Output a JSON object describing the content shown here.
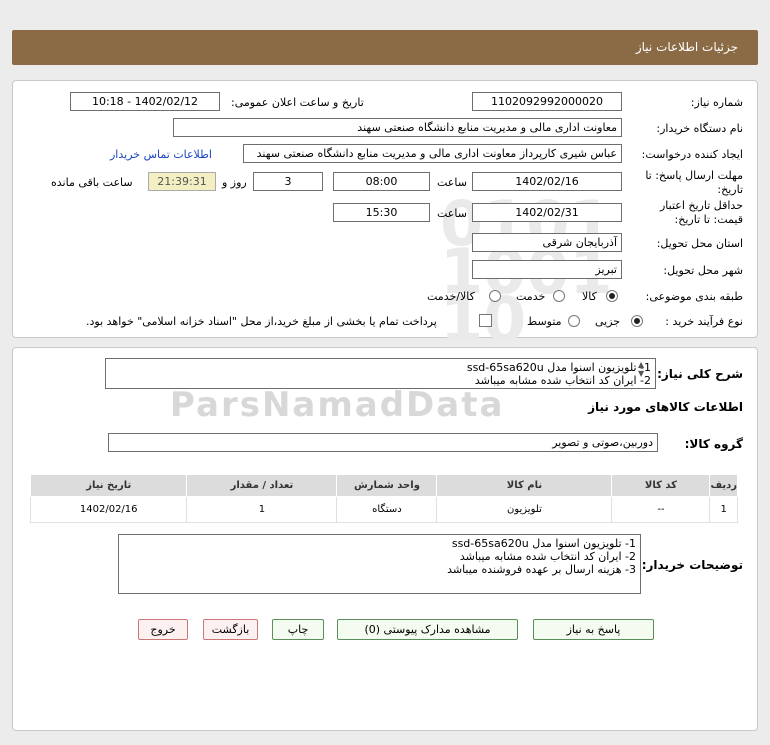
{
  "header": {
    "title": "جزئیات اطلاعات نیاز"
  },
  "form": {
    "need_number": {
      "label": "شماره نیاز:",
      "value": "1102092992000020"
    },
    "announce_datetime": {
      "label": "تاریخ و ساعت اعلان عمومی:",
      "value": "1402/02/12 - 10:18"
    },
    "buyer_org": {
      "label": "نام دستگاه خریدار:",
      "value": "معاونت اداری  مالی و مدیریت منابع دانشگاه صنعتی سهند"
    },
    "requester": {
      "label": "ایجاد کننده درخواست:",
      "value": "عباس شیری کارپرداز معاونت اداری  مالی و مدیریت منابع دانشگاه صنعتی سهند",
      "contact_link": "اطلاعات تماس خریدار"
    },
    "reply_deadline": {
      "label_line1": "مهلت ارسال پاسخ: تا",
      "label_line2": "تاریخ:",
      "date": "1402/02/16",
      "time_label": "ساعت",
      "time": "08:00",
      "days": "3",
      "days_label": "روز و",
      "remaining": "21:39:31",
      "remaining_label": "ساعت باقی مانده"
    },
    "price_validity": {
      "label_line1": "حداقل تاریخ اعتبار",
      "label_line2": "قیمت: تا تاریخ:",
      "date": "1402/02/31",
      "time_label": "ساعت",
      "time": "15:30"
    },
    "delivery_province": {
      "label": "استان محل تحویل:",
      "value": "آذربایجان شرقی"
    },
    "delivery_city": {
      "label": "شهر محل تحویل:",
      "value": "تبریز"
    },
    "category": {
      "label": "طبقه بندی موضوعی:",
      "options": [
        "کالا",
        "خدمت",
        "کالا/خدمت"
      ],
      "selected": "کالا"
    },
    "purchase_type": {
      "label": "نوع فرآیند خرید :",
      "options": [
        "جزیی",
        "متوسط"
      ],
      "selected": "جزیی",
      "payment_note": "پرداخت تمام یا بخشی از مبلغ خرید،از محل \"اسناد خزانه اسلامی\" خواهد بود."
    }
  },
  "summary": {
    "label": "شرح کلی نیاز:",
    "text": "1- تلویزیون اسنوا مدل ssd-65sa620u\n2- ایران کد انتخاب شده مشابه میباشد",
    "goods_info_title": "اطلاعات کالاهای مورد نیاز",
    "goods_group_label": "گروه کالا:",
    "goods_group_value": "دوربین،صوتی و تصویر"
  },
  "table": {
    "columns": [
      "ردیف",
      "کد کالا",
      "نام کالا",
      "واحد شمارش",
      "تعداد / مقدار",
      "تاریخ نیاز"
    ],
    "rows": [
      [
        "1",
        "--",
        "تلویزیون",
        "دستگاه",
        "1",
        "1402/02/16"
      ]
    ]
  },
  "buyer_notes": {
    "label": "توضیحات خریدار:",
    "text": "1- تلویزیون اسنوا مدل ssd-65sa620u\n2- ایران کد انتخاب شده مشابه میباشد\n3- هزینه ارسال بر عهده فروشنده میباشد"
  },
  "buttons": {
    "reply": "پاسخ به نیاز",
    "attachments": "مشاهده مدارک پیوستی (0)",
    "print": "چاپ",
    "back": "بازگشت",
    "exit": "خروج"
  },
  "watermark": {
    "text": "ParsNamadData"
  },
  "colors": {
    "header_bg": "#8b6b45",
    "link": "#1a44c2",
    "remaining_bg": "#f3efc3"
  }
}
